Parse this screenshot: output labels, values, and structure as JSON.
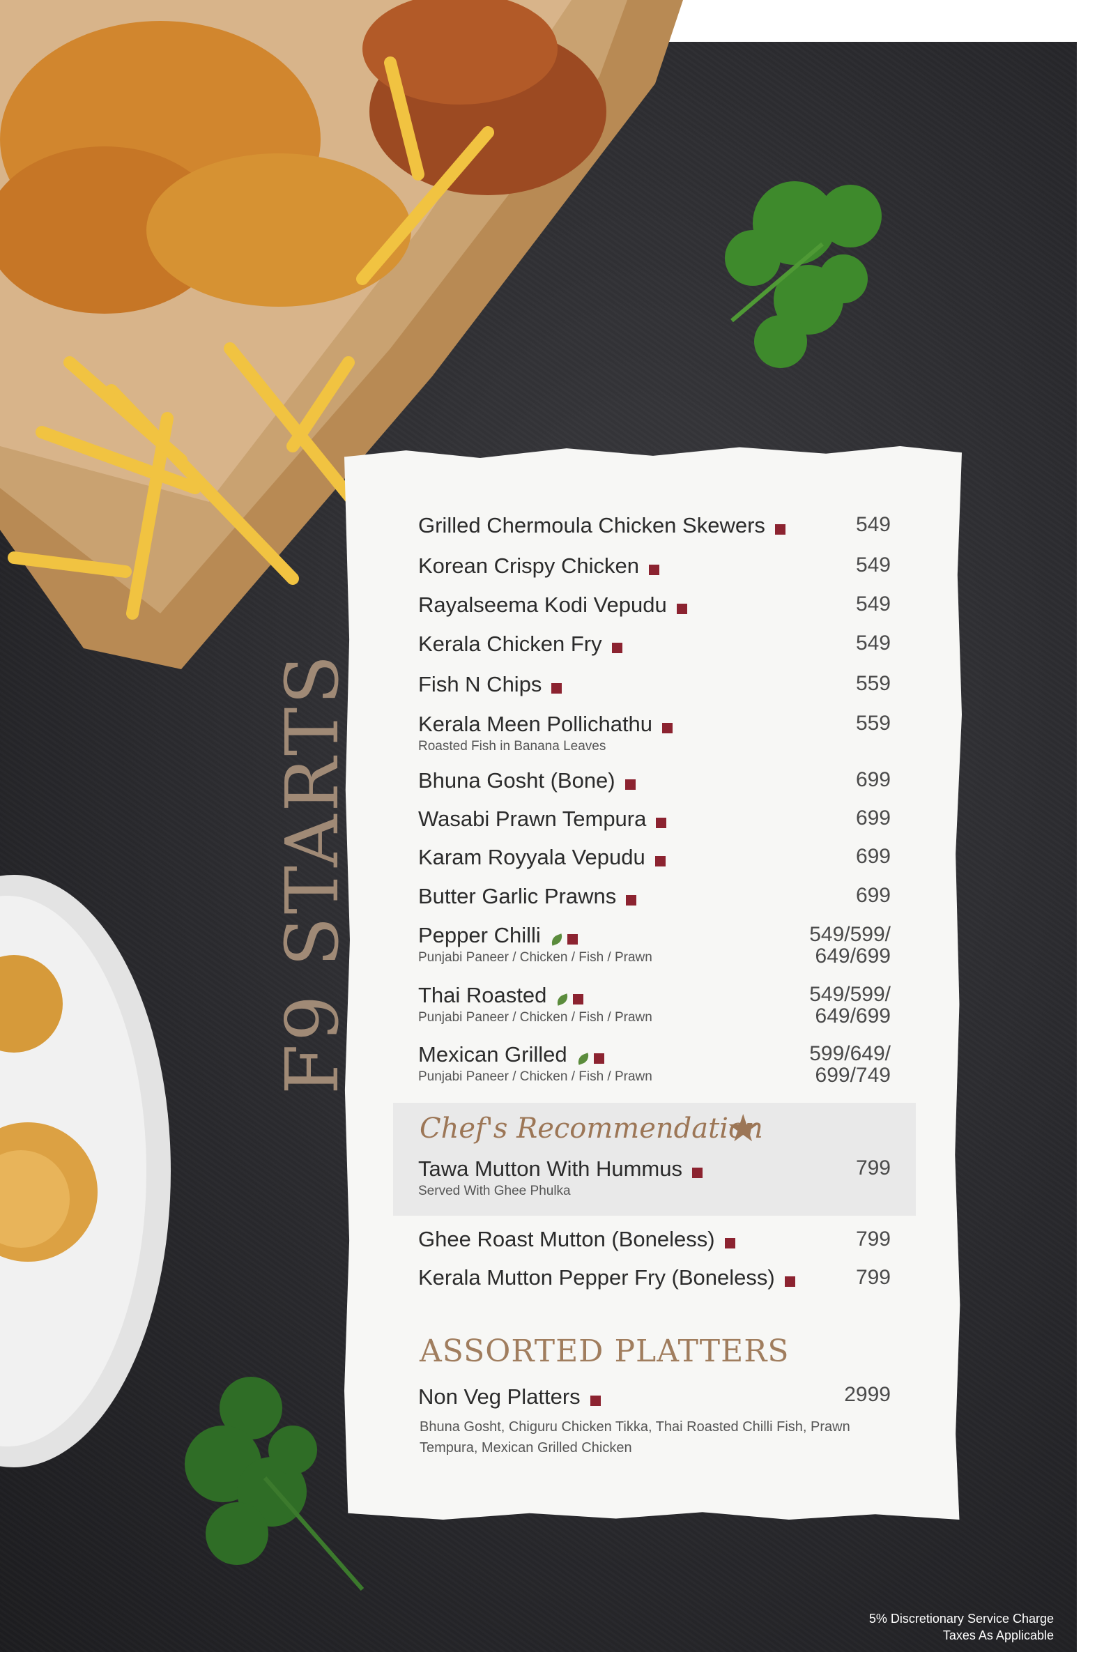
{
  "section_title": "F9 STARTS",
  "items": [
    {
      "name": "Grilled Chermoula Chicken Skewers",
      "price": "549",
      "veg_option": false
    },
    {
      "name": "Korean Crispy Chicken",
      "price": "549",
      "veg_option": false
    },
    {
      "name": "Rayalseema Kodi Vepudu",
      "price": "549",
      "veg_option": false
    },
    {
      "name": "Kerala Chicken Fry",
      "price": "549",
      "veg_option": false
    },
    {
      "name": "Fish N Chips",
      "price": "559",
      "veg_option": false
    },
    {
      "name": "Kerala Meen Pollichathu",
      "desc": "Roasted Fish in Banana Leaves",
      "price": "559",
      "veg_option": false
    },
    {
      "name": "Bhuna Gosht (Bone)",
      "price": "699",
      "veg_option": false
    },
    {
      "name": "Wasabi Prawn Tempura",
      "price": "699",
      "veg_option": false
    },
    {
      "name": "Karam Royyala Vepudu",
      "price": "699",
      "veg_option": false
    },
    {
      "name": "Butter Garlic Prawns",
      "price": "699",
      "veg_option": false
    },
    {
      "name": "Pepper Chilli",
      "desc": "Punjabi Paneer / Chicken / Fish / Prawn",
      "price_line1": "549/599/",
      "price_line2": "649/699",
      "veg_option": true
    },
    {
      "name": "Thai Roasted",
      "desc": "Punjabi Paneer / Chicken / Fish / Prawn",
      "price_line1": "549/599/",
      "price_line2": "649/699",
      "veg_option": true
    },
    {
      "name": "Mexican Grilled",
      "desc": "Punjabi Paneer / Chicken / Fish / Prawn",
      "price_line1": "599/649/",
      "price_line2": "699/749",
      "veg_option": true
    }
  ],
  "chefs_recommendation": {
    "title": "Chef's Recommendation",
    "item": {
      "name": "Tawa Mutton With Hummus",
      "desc": "Served With Ghee Phulka",
      "price": "799"
    }
  },
  "mutton_items": [
    {
      "name": "Ghee Roast Mutton (Boneless)",
      "price": "799"
    },
    {
      "name": "Kerala Mutton Pepper Fry (Boneless)",
      "price": "799"
    }
  ],
  "platters": {
    "title": "ASSORTED PLATTERS",
    "item": {
      "name": "Non Veg Platters",
      "price": "2999",
      "desc": "Bhuna Gosht, Chiguru Chicken Tikka, Thai Roasted Chilli Fish, Prawn Tempura, Mexican Grilled Chicken"
    }
  },
  "footer": {
    "line1": "5% Discretionary Service Charge",
    "line2": "Taxes As Applicable"
  },
  "colors": {
    "board": "#2a2a2e",
    "marker": "#8c2330",
    "veg": "#5b8c3c",
    "accent": "#9c7656",
    "paper": "#f7f7f5"
  }
}
